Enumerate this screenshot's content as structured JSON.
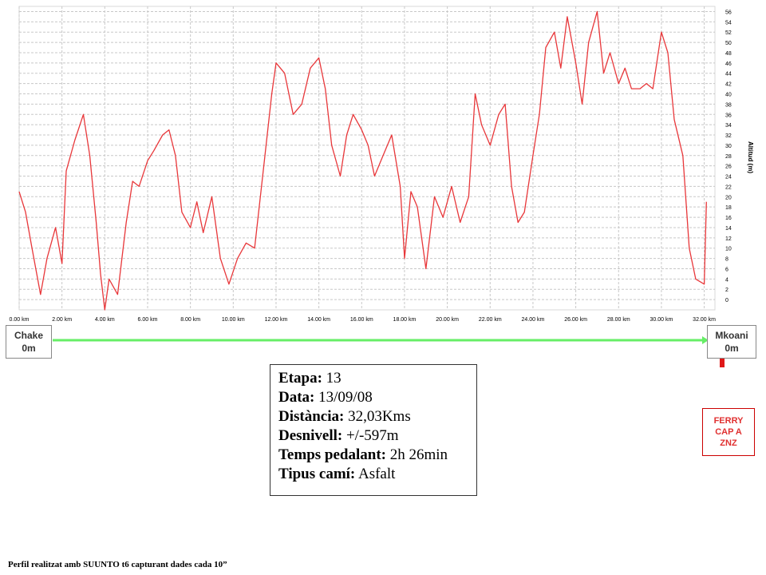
{
  "chart_data": {
    "type": "line",
    "ylabel": "Altitud (m)",
    "x_unit": "km",
    "xlim": [
      0,
      32.5
    ],
    "ylim": [
      -2,
      57
    ],
    "x_ticks": [
      "0.00 km",
      "2.00 km",
      "4.00 km",
      "6.00 km",
      "8.00 km",
      "10.00 km",
      "12.00 km",
      "14.00 km",
      "16.00 km",
      "18.00 km",
      "20.00 km",
      "22.00 km",
      "24.00 km",
      "26.00 km",
      "28.00 km",
      "30.00 km",
      "32.00 km"
    ],
    "y_ticks": [
      0,
      2,
      4,
      6,
      8,
      10,
      12,
      14,
      16,
      18,
      20,
      22,
      24,
      26,
      28,
      30,
      32,
      34,
      36,
      38,
      40,
      42,
      44,
      46,
      48,
      50,
      52,
      54,
      56
    ],
    "grid": true,
    "series": [
      {
        "color": "#e8373a",
        "x": [
          0.0,
          0.3,
          0.6,
          1.0,
          1.3,
          1.7,
          2.0,
          2.2,
          2.6,
          3.0,
          3.3,
          3.6,
          3.8,
          4.0,
          4.2,
          4.6,
          5.0,
          5.3,
          5.6,
          6.0,
          6.3,
          6.7,
          7.0,
          7.3,
          7.6,
          8.0,
          8.3,
          8.6,
          9.0,
          9.4,
          9.8,
          10.2,
          10.6,
          11.0,
          11.4,
          11.8,
          12.0,
          12.4,
          12.8,
          13.2,
          13.6,
          14.0,
          14.3,
          14.6,
          15.0,
          15.3,
          15.6,
          16.0,
          16.3,
          16.6,
          17.0,
          17.4,
          17.8,
          18.0,
          18.3,
          18.6,
          19.0,
          19.4,
          19.8,
          20.2,
          20.6,
          21.0,
          21.3,
          21.6,
          22.0,
          22.4,
          22.7,
          23.0,
          23.3,
          23.6,
          24.0,
          24.3,
          24.6,
          25.0,
          25.3,
          25.6,
          26.0,
          26.3,
          26.6,
          27.0,
          27.3,
          27.6,
          28.0,
          28.3,
          28.6,
          29.0,
          29.3,
          29.6,
          30.0,
          30.3,
          30.6,
          31.0,
          31.3,
          31.6,
          32.0,
          32.1
        ],
        "values": [
          21,
          17,
          10,
          1,
          8,
          14,
          7,
          25,
          31,
          36,
          28,
          15,
          5,
          -2,
          4,
          1,
          15,
          23,
          22,
          27,
          29,
          32,
          33,
          28,
          17,
          14,
          19,
          13,
          20,
          8,
          3,
          8,
          11,
          10,
          25,
          40,
          46,
          44,
          36,
          38,
          45,
          47,
          41,
          30,
          24,
          32,
          36,
          33,
          30,
          24,
          28,
          32,
          22,
          8,
          21,
          18,
          6,
          20,
          16,
          22,
          15,
          20,
          40,
          34,
          30,
          36,
          38,
          22,
          15,
          17,
          28,
          36,
          49,
          52,
          45,
          55,
          46,
          38,
          50,
          56,
          44,
          48,
          42,
          45,
          41,
          41,
          42,
          41,
          52,
          48,
          35,
          28,
          10,
          4,
          3,
          19
        ]
      }
    ]
  },
  "start": {
    "name": "Chake",
    "alt": "0m"
  },
  "end": {
    "name": "Mkoani",
    "alt": "0m"
  },
  "ferry": {
    "line1": "FERRY",
    "line2": "CAP A",
    "line3": "ZNZ"
  },
  "info": {
    "etapa_label": "Etapa:",
    "etapa": "13",
    "data_label": "Data:",
    "data": "13/09/08",
    "distancia_label": "Distància:",
    "distancia": "32,03Kms",
    "desnivell_label": "Desnivell:",
    "desnivell": "+/-597m",
    "temps_label": "Temps pedalant:",
    "temps": "2h 26min",
    "cami_label": "Tipus camí:",
    "cami": "Asfalt"
  },
  "footer": "Perfil realitzat amb SUUNTO t6 capturant dades cada 10”",
  "colors": {
    "profile": "#e8373a",
    "route": "#66ee66",
    "arrow": "#e01818",
    "grid": "#c8c8c8"
  }
}
